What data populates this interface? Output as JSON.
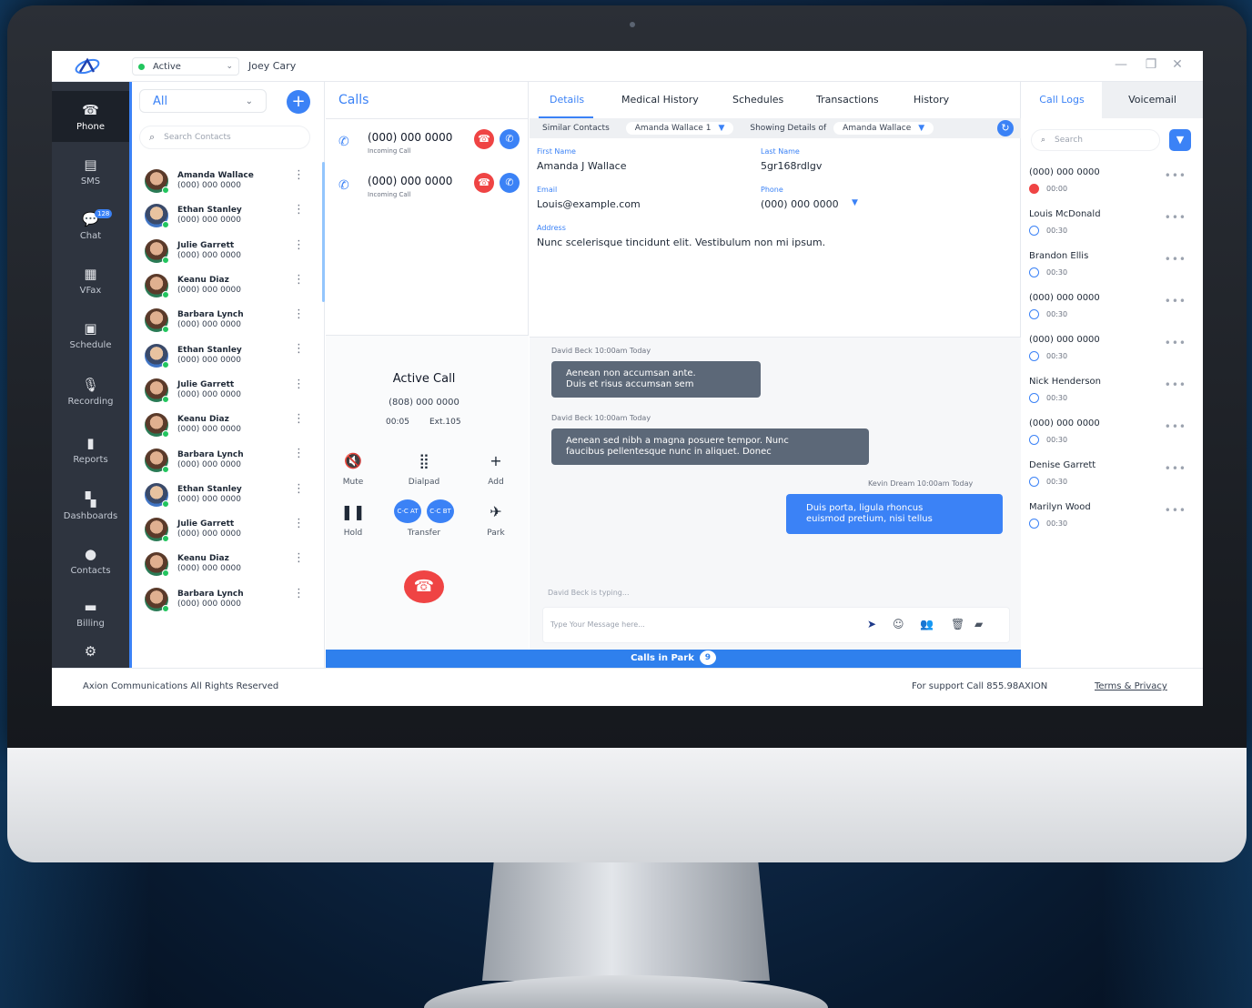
{
  "titlebar": {
    "status": "Active",
    "user": "Joey Cary",
    "minimize": "—",
    "restore": "❐",
    "close": "✕"
  },
  "nav": [
    {
      "label": "Phone",
      "icon": "phone-icon",
      "glyph": "☎"
    },
    {
      "label": "SMS",
      "icon": "sms-icon",
      "glyph": "▤"
    },
    {
      "label": "Chat",
      "icon": "chat-icon",
      "glyph": "💬",
      "badge": "128"
    },
    {
      "label": "VFax",
      "icon": "fax-icon",
      "glyph": "▦"
    },
    {
      "label": "Schedule",
      "icon": "calendar-icon",
      "glyph": "▣"
    },
    {
      "label": "Recording",
      "icon": "microphone-icon",
      "glyph": "🎙"
    },
    {
      "label": "Reports",
      "icon": "report-icon",
      "glyph": "▮"
    },
    {
      "label": "Dashboards",
      "icon": "dashboard-icon",
      "glyph": "▚"
    },
    {
      "label": "Contacts",
      "icon": "person-icon",
      "glyph": "●"
    },
    {
      "label": "Billing",
      "icon": "billing-icon",
      "glyph": "▬"
    },
    {
      "label": "",
      "icon": "gear-icon",
      "glyph": "⚙"
    }
  ],
  "contacts": {
    "filter": "All",
    "search_placeholder": "Search Contacts",
    "items": [
      {
        "name": "Amanda Wallace",
        "phone": "(000) 000 0000"
      },
      {
        "name": "Ethan Stanley",
        "phone": "(000) 000 0000"
      },
      {
        "name": "Julie Garrett",
        "phone": "(000) 000 0000"
      },
      {
        "name": "Keanu Diaz",
        "phone": "(000) 000 0000"
      },
      {
        "name": "Barbara Lynch",
        "phone": "(000) 000 0000"
      },
      {
        "name": "Ethan Stanley",
        "phone": "(000) 000 0000"
      },
      {
        "name": "Julie Garrett",
        "phone": "(000) 000 0000"
      },
      {
        "name": "Keanu Diaz",
        "phone": "(000) 000 0000"
      },
      {
        "name": "Barbara Lynch",
        "phone": "(000) 000 0000"
      },
      {
        "name": "Ethan Stanley",
        "phone": "(000) 000 0000"
      },
      {
        "name": "Julie Garrett",
        "phone": "(000) 000 0000"
      },
      {
        "name": "Keanu Diaz",
        "phone": "(000) 000 0000"
      },
      {
        "name": "Barbara Lynch",
        "phone": "(000) 000 0000"
      }
    ]
  },
  "calls": {
    "title": "Calls",
    "incoming": [
      {
        "number": "(000) 000 0000",
        "label": "Incoming Call"
      },
      {
        "number": "(000) 000 0000",
        "label": "Incoming Call"
      }
    ],
    "active": {
      "title": "Active Call",
      "number": "(808) 000 0000",
      "timer": "00:05",
      "ext": "Ext.105",
      "controls": {
        "mute": "Mute",
        "dialpad": "Dialpad",
        "add": "Add",
        "hold": "Hold",
        "transfer": "Transfer",
        "park": "Park",
        "xfer_at": "C-C AT",
        "xfer_bt": "C-C BT"
      }
    }
  },
  "details": {
    "tabs": [
      "Details",
      "Medical History",
      "Schedules",
      "Transactions",
      "History"
    ],
    "similar_label": "Similar Contacts",
    "similar_value": "Amanda Wallace 1",
    "showing_label": "Showing Details of",
    "showing_value": "Amanda Wallace",
    "first_name_label": "First Name",
    "first_name": "Amanda J Wallace",
    "last_name_label": "Last Name",
    "last_name": "5gr168rdlgv",
    "email_label": "Email",
    "email": "Louis@example.com",
    "phone_label": "Phone",
    "phone": "(000) 000 0000",
    "address_label": "Address",
    "address": "Nunc scelerisque tincidunt elit. Vestibulum non mi ipsum."
  },
  "chat": {
    "messages": [
      {
        "meta": "David Beck 10:00am   Today",
        "text1": "Aenean non accumsan ante.",
        "text2": "Duis et risus accumsan sem"
      },
      {
        "meta": "David Beck 10:00am   Today",
        "text1": "Aenean sed nibh a magna posuere tempor. Nunc",
        "text2": "faucibus pellentesque nunc in aliquet. Donec"
      },
      {
        "meta": "Kevin Dream 10:00am   Today",
        "text1": "Duis porta, ligula rhoncus",
        "text2": "euismod pretium, nisi tellus"
      }
    ],
    "typing": "David Beck is typing...",
    "composer_placeholder": "Type Your Message here..."
  },
  "park": {
    "label": "Calls in Park",
    "count": "9"
  },
  "logs": {
    "tabs": [
      "Call Logs",
      "Voicemail"
    ],
    "search_placeholder": "Search",
    "items": [
      {
        "name": "(000) 000 0000",
        "duration": "00:00",
        "missed": true
      },
      {
        "name": "Louis McDonald",
        "duration": "00:30",
        "missed": false
      },
      {
        "name": "Brandon Ellis",
        "duration": "00:30",
        "missed": false
      },
      {
        "name": "(000) 000 0000",
        "duration": "00:30",
        "missed": false
      },
      {
        "name": "(000) 000 0000",
        "duration": "00:30",
        "missed": false
      },
      {
        "name": "Nick Henderson",
        "duration": "00:30",
        "missed": false
      },
      {
        "name": "(000) 000 0000",
        "duration": "00:30",
        "missed": false
      },
      {
        "name": "Denise Garrett",
        "duration": "00:30",
        "missed": false
      },
      {
        "name": "Marilyn Wood",
        "duration": "00:30",
        "missed": false
      }
    ]
  },
  "footer": {
    "copyright": "Axion Communications All Rights Reserved",
    "support": "For support Call 855.98AXION",
    "terms": "Terms & Privacy"
  },
  "colors": {
    "accent": "#3b82f6",
    "danger": "#ef4444",
    "rail": "#2e343f",
    "online": "#22c55e"
  }
}
